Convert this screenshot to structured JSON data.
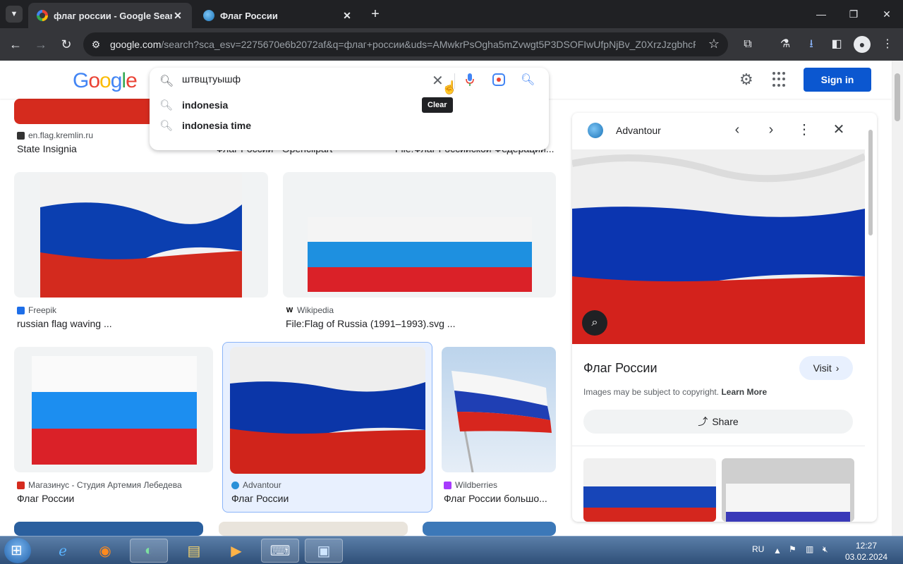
{
  "browser": {
    "tabs": [
      {
        "title": "флаг россии - Google Search",
        "active": true
      },
      {
        "title": "Флаг России",
        "active": false
      }
    ],
    "url_host": "google.com",
    "url_path": "/search?sca_esv=2275670e6b2072af&q=флаг+россии&uds=AMwkrPsOgha5mZvwgt5P3DSOFIwUfpNjBv_Z0XrzJzgbhcFo..."
  },
  "google": {
    "logo": [
      "G",
      "o",
      "o",
      "g",
      "l",
      "e"
    ],
    "sign_in_label": "Sign in",
    "search": {
      "value": "штвщтуышф",
      "suggestions": [
        "indonesia",
        "indonesia time"
      ],
      "clear_tooltip": "Clear"
    }
  },
  "results": [
    {
      "source": "en.flag.kremlin.ru",
      "title": "State Insignia"
    },
    {
      "source": "",
      "title": "Флаг России - Openclipart"
    },
    {
      "source": "",
      "title": "File:Флаг Российской Федерации..."
    },
    {
      "source": "Freepik",
      "title": "russian flag waving ..."
    },
    {
      "source": "Wikipedia",
      "title": "File:Flag of Russia (1991–1993).svg ..."
    },
    {
      "source": "Магазинус - Студия Артемия Лебедева",
      "title": "Флаг России"
    },
    {
      "source": "Advantour",
      "title": "Флаг России"
    },
    {
      "source": "Wildberries",
      "title": "Флаг России большо..."
    }
  ],
  "panel": {
    "site": "Advantour",
    "title": "Флаг России",
    "visit_label": "Visit",
    "copyright_text": "Images may be subject to copyright.",
    "learn_more": "Learn More",
    "share_label": "Share"
  },
  "taskbar": {
    "language": "RU",
    "time": "12:27",
    "date": "03.02.2024"
  },
  "colors": {
    "flag_white": "#f4f4f4",
    "flag_blue": "#0039a6",
    "flag_red": "#d52b1e",
    "accent": "#0b57d0"
  }
}
